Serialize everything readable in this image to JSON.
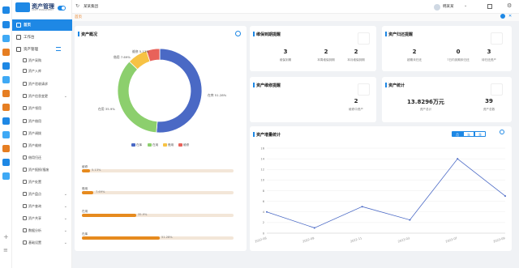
{
  "app": {
    "title": "资产管理",
    "subtitle": "ASSET MANAGEMENT"
  },
  "topbar": {
    "title": "某某集团",
    "user": "韩某某"
  },
  "tabs": {
    "home": "首页"
  },
  "sidebar": {
    "home": "首页",
    "workbench": "工作台",
    "asset_mgmt": "资产管理",
    "items": [
      "资产采购",
      "资产入库",
      "资产验收请求",
      "资产信息变更",
      "资产领用",
      "资产借用",
      "资产调拨",
      "资产维修",
      "借用归还",
      "资产报损/报废",
      "资产处置"
    ],
    "groups": [
      "资产盘点",
      "资产查询",
      "资产共享",
      "数据分析",
      "基础设置"
    ]
  },
  "overview": {
    "title": "资产概况"
  },
  "expire": {
    "title": "维保到期提醒",
    "stats": [
      {
        "value": "3",
        "label": "维保到期"
      },
      {
        "value": "2",
        "label": "本周维保到期"
      },
      {
        "value": "2",
        "label": "本月维保到期"
      }
    ]
  },
  "return": {
    "title": "资产归还提醒",
    "stats": [
      {
        "value": "2",
        "label": "超期未归还"
      },
      {
        "value": "0",
        "label": "7日内到期未归还"
      },
      {
        "value": "3",
        "label": "待归还资产"
      }
    ]
  },
  "repair": {
    "title": "资产维修提醒",
    "stats": [
      {
        "value": "2",
        "label": "维修中资产"
      }
    ]
  },
  "assets": {
    "title": "资产统计",
    "stats": [
      {
        "value": "13.8296万元",
        "label": "资产总计"
      },
      {
        "value": "39",
        "label": "资产总数"
      }
    ]
  },
  "growth": {
    "title": "资产增量统计",
    "segments": [
      "月",
      "年",
      "季"
    ]
  },
  "colors": {
    "primary": "#1e88e5",
    "accent": "#e68a1e",
    "ring": [
      "#4a69c5",
      "#8ccf6d",
      "#f7c244",
      "#e8625a"
    ]
  },
  "chart_data": [
    {
      "type": "pie",
      "title": "",
      "categories": [
        "在库",
        "在用",
        "借用",
        "维修"
      ],
      "values": [
        51.28,
        35.9,
        7.69,
        5.13
      ],
      "labels": [
        "在库 51.28%",
        "在用 35.9%",
        "借用 7.69%",
        "维修 5.13%"
      ],
      "legend": "bottom"
    },
    {
      "type": "bar",
      "categories": [
        "维修",
        "借用",
        "在用",
        "在库"
      ],
      "values": [
        5.13,
        7.69,
        35.9,
        51.28
      ],
      "labels": [
        "5.13%",
        "7.69%",
        "35.9%",
        "51.28%"
      ]
    },
    {
      "type": "line",
      "x": [
        "2022-06",
        "2022-09",
        "2022-11",
        "2023-03",
        "2023-07",
        "2023-09"
      ],
      "series": [
        {
          "values": [
            4,
            1,
            5,
            2.5,
            14,
            7
          ]
        }
      ],
      "yticks": [
        "16",
        "14",
        "12",
        "10",
        "8",
        "6",
        "4",
        "2",
        "0"
      ],
      "ylim": [
        0,
        16
      ]
    }
  ]
}
